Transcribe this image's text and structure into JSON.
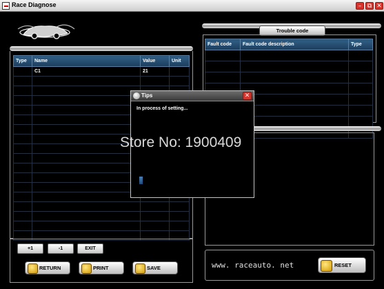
{
  "window": {
    "title": "Race Diagnose",
    "controls": [
      "minimize",
      "restore",
      "close"
    ]
  },
  "logo": {
    "icon": "race-car-logo"
  },
  "trouble_code": {
    "header_label": "Trouble code",
    "columns": [
      "Fault code",
      "Fault code description",
      "Type"
    ],
    "rows": []
  },
  "variables": {
    "columns": [
      "Type",
      "Name",
      "Value",
      "Unit"
    ],
    "rows": [
      {
        "type": "",
        "name": "C1",
        "value": "21",
        "unit": ""
      }
    ]
  },
  "stepper": {
    "plus_label": "+1",
    "minus_label": "-1",
    "exit_label": "EXIT"
  },
  "actions": {
    "return_label": "RETURN",
    "print_label": "PRINT",
    "save_label": "SAVE",
    "reset_label": "RESET"
  },
  "footer": {
    "website": "www. raceauto. net"
  },
  "dialog": {
    "title": "Tips",
    "message": "In process of setting...",
    "progress": 0.05
  },
  "watermark": "Store No: 1900409",
  "colors": {
    "background": "#000000",
    "header_blue": "#2a5578",
    "close_red": "#d9332b"
  }
}
